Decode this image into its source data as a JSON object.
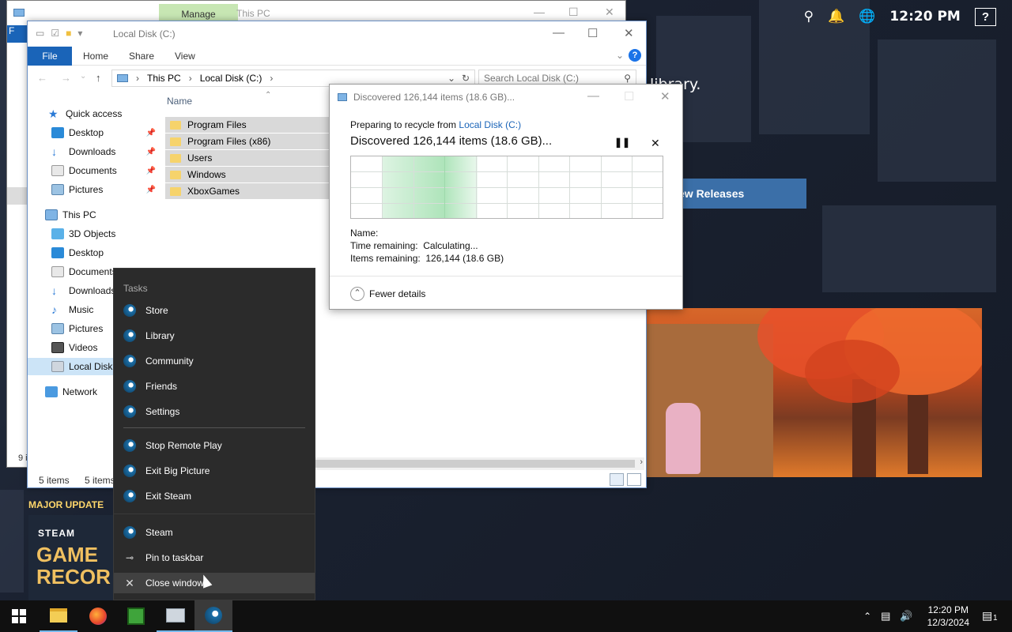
{
  "steam": {
    "clock": "12:20 PM",
    "help": "?",
    "library_text": "library.",
    "new_releases": "ew Releases",
    "major_update": "MAJOR UPDATE",
    "promo_brand": "STEAM",
    "promo_big1": "GAME",
    "promo_big2": "RECOR"
  },
  "back_window": {
    "manage_tab": "Manage",
    "title": "This PC",
    "ribbon_file": "F",
    "status": "9 i"
  },
  "explorer": {
    "title": "Local Disk (C:)",
    "tabs": [
      "File",
      "Home",
      "Share",
      "View"
    ],
    "address": [
      "This PC",
      "Local Disk (C:)"
    ],
    "search_placeholder": "Search Local Disk (C:)",
    "column_name": "Name",
    "nav": [
      {
        "label": "Quick access"
      },
      {
        "label": "Desktop"
      },
      {
        "label": "Downloads"
      },
      {
        "label": "Documents"
      },
      {
        "label": "Pictures"
      },
      {
        "label": "This PC"
      },
      {
        "label": "3D Objects"
      },
      {
        "label": "Desktop"
      },
      {
        "label": "Documents"
      },
      {
        "label": "Downloads"
      },
      {
        "label": "Music"
      },
      {
        "label": "Pictures"
      },
      {
        "label": "Videos"
      },
      {
        "label": "Local Disk (C:)"
      },
      {
        "label": "Network"
      }
    ],
    "files": [
      "Program Files",
      "Program Files (x86)",
      "Users",
      "Windows",
      "XboxGames"
    ],
    "status_left": "5 items",
    "status_right": "5 items"
  },
  "progress": {
    "title": "Discovered 126,144 items (18.6 GB)...",
    "preparing_prefix": "Preparing to recycle from",
    "preparing_link": "Local Disk (C:)",
    "headline": "Discovered 126,144 items (18.6 GB)...",
    "name_label": "Name:",
    "time_label": "Time remaining:",
    "time_value": "Calculating...",
    "items_label": "Items remaining:",
    "items_value": "126,144 (18.6 GB)",
    "fewer_details": "Fewer details"
  },
  "jumplist": {
    "header": "Tasks",
    "tasks": [
      "Store",
      "Library",
      "Community",
      "Friends",
      "Settings"
    ],
    "tasks2": [
      "Stop Remote Play",
      "Exit Big Picture",
      "Exit Steam"
    ],
    "app": "Steam",
    "pin": "Pin to taskbar",
    "close": "Close window"
  },
  "taskbar": {
    "time": "12:20 PM",
    "date": "12/3/2024",
    "notifications": "1"
  }
}
